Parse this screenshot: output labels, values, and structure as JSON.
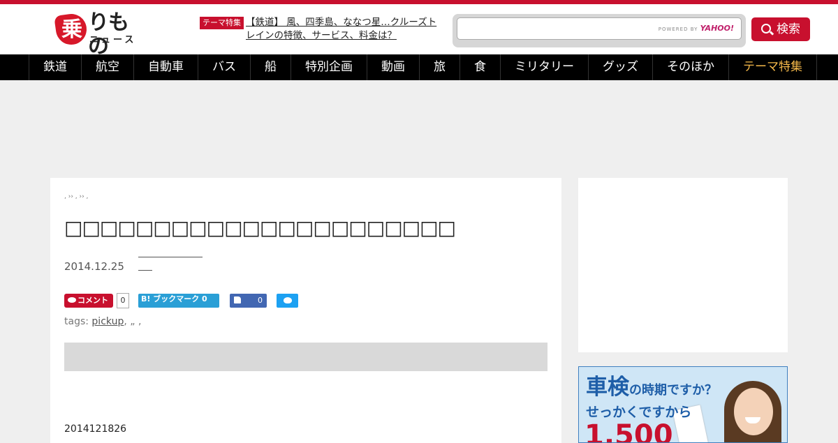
{
  "header": {
    "logo_main": "りもの",
    "logo_badge": "乗",
    "logo_sub": "ニュース",
    "theme_label": "テーマ特集",
    "theme_link": "【鉄道】 風、四季島、ななつ星…クルーズトレインの特徴、サービス、料金は？",
    "search_placeholder": "",
    "powered_by": "POWERED BY",
    "powered_brand": "YAHOO!",
    "search_button": "検索"
  },
  "nav": {
    "items": [
      "鉄道",
      "航空",
      "自動車",
      "バス",
      "船",
      "特別企画",
      "動画",
      "旅",
      "食",
      "ミリタリー",
      "グッズ",
      "そのほか",
      "テーマ特集"
    ]
  },
  "article": {
    "breadcrumb": ", ›› , ›› ,",
    "title": "□□□□□□□□□□□□□□□□□□□□□□",
    "date": "2014.12.25",
    "comment_label": "コメント",
    "comment_count": "0",
    "hatena_label": "B! ブックマーク 0",
    "like_count": "0",
    "tags_prefix": "tags:",
    "tag_link": "pickup",
    "tags_rest": ", „ ,",
    "body_start": "2014121826"
  },
  "sidebar_ad": {
    "line1_big": "車検",
    "line1_rest": "の時期ですか？",
    "line2": "せっかくですから",
    "line3": "1,500"
  },
  "colors": {
    "brand_red": "#c8102e",
    "nav_bg": "#000000",
    "nav_theme_text": "#f5b94a",
    "page_bg": "#efefef"
  }
}
